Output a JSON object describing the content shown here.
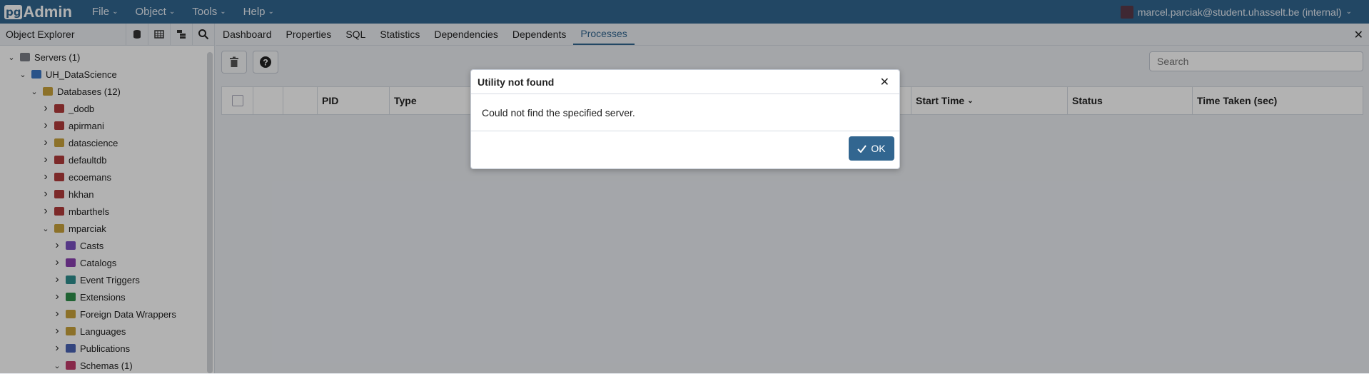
{
  "app": {
    "logo_pg": "pg",
    "logo_admin": "Admin"
  },
  "menu": [
    "File",
    "Object",
    "Tools",
    "Help"
  ],
  "user": {
    "label": "marcel.parciak@student.uhasselt.be (internal)"
  },
  "left_panel": {
    "title": "Object Explorer",
    "tree": [
      {
        "label": "Servers (1)",
        "level": 0,
        "expanded": true,
        "icon": "servers-icon",
        "color": "#7b7f87"
      },
      {
        "label": "UH_DataScience",
        "level": 1,
        "expanded": true,
        "icon": "server-icon",
        "color": "#3b78c4"
      },
      {
        "label": "Databases (12)",
        "level": 2,
        "expanded": true,
        "icon": "databases-icon",
        "color": "#c9a23b"
      },
      {
        "label": "_dodb",
        "level": 3,
        "expanded": false,
        "icon": "database-icon",
        "color": "#b23c3c"
      },
      {
        "label": "apirmani",
        "level": 3,
        "expanded": false,
        "icon": "database-icon",
        "color": "#b23c3c"
      },
      {
        "label": "datascience",
        "level": 3,
        "expanded": false,
        "icon": "database-icon",
        "color": "#c9a23b"
      },
      {
        "label": "defaultdb",
        "level": 3,
        "expanded": false,
        "icon": "database-icon",
        "color": "#b23c3c"
      },
      {
        "label": "ecoemans",
        "level": 3,
        "expanded": false,
        "icon": "database-icon",
        "color": "#b23c3c"
      },
      {
        "label": "hkhan",
        "level": 3,
        "expanded": false,
        "icon": "database-icon",
        "color": "#b23c3c"
      },
      {
        "label": "mbarthels",
        "level": 3,
        "expanded": false,
        "icon": "database-icon",
        "color": "#b23c3c"
      },
      {
        "label": "mparciak",
        "level": 3,
        "expanded": true,
        "icon": "database-icon",
        "color": "#c9a23b"
      },
      {
        "label": "Casts",
        "level": 4,
        "expanded": false,
        "icon": "casts-icon",
        "color": "#7a4fc0"
      },
      {
        "label": "Catalogs",
        "level": 4,
        "expanded": false,
        "icon": "catalogs-icon",
        "color": "#8a3fb0"
      },
      {
        "label": "Event Triggers",
        "level": 4,
        "expanded": false,
        "icon": "event-triggers-icon",
        "color": "#2f8f8f"
      },
      {
        "label": "Extensions",
        "level": 4,
        "expanded": false,
        "icon": "extensions-icon",
        "color": "#2f8f4a"
      },
      {
        "label": "Foreign Data Wrappers",
        "level": 4,
        "expanded": false,
        "icon": "fdw-icon",
        "color": "#c9a23b"
      },
      {
        "label": "Languages",
        "level": 4,
        "expanded": false,
        "icon": "languages-icon",
        "color": "#c9a23b"
      },
      {
        "label": "Publications",
        "level": 4,
        "expanded": false,
        "icon": "publications-icon",
        "color": "#4a63b5"
      },
      {
        "label": "Schemas (1)",
        "level": 4,
        "expanded": true,
        "icon": "schemas-icon",
        "color": "#c23c6a"
      }
    ]
  },
  "tabs": [
    {
      "label": "Dashboard",
      "active": false
    },
    {
      "label": "Properties",
      "active": false
    },
    {
      "label": "SQL",
      "active": false
    },
    {
      "label": "Statistics",
      "active": false
    },
    {
      "label": "Dependencies",
      "active": false
    },
    {
      "label": "Dependents",
      "active": false
    },
    {
      "label": "Processes",
      "active": true
    }
  ],
  "toolbar": {
    "search_placeholder": "Search"
  },
  "table": {
    "columns": [
      "",
      "",
      "",
      "PID",
      "Type",
      "Start Time",
      "Status",
      "Time Taken (sec)"
    ]
  },
  "modal": {
    "title": "Utility not found",
    "message": "Could not find the specified server.",
    "ok_label": "OK"
  }
}
